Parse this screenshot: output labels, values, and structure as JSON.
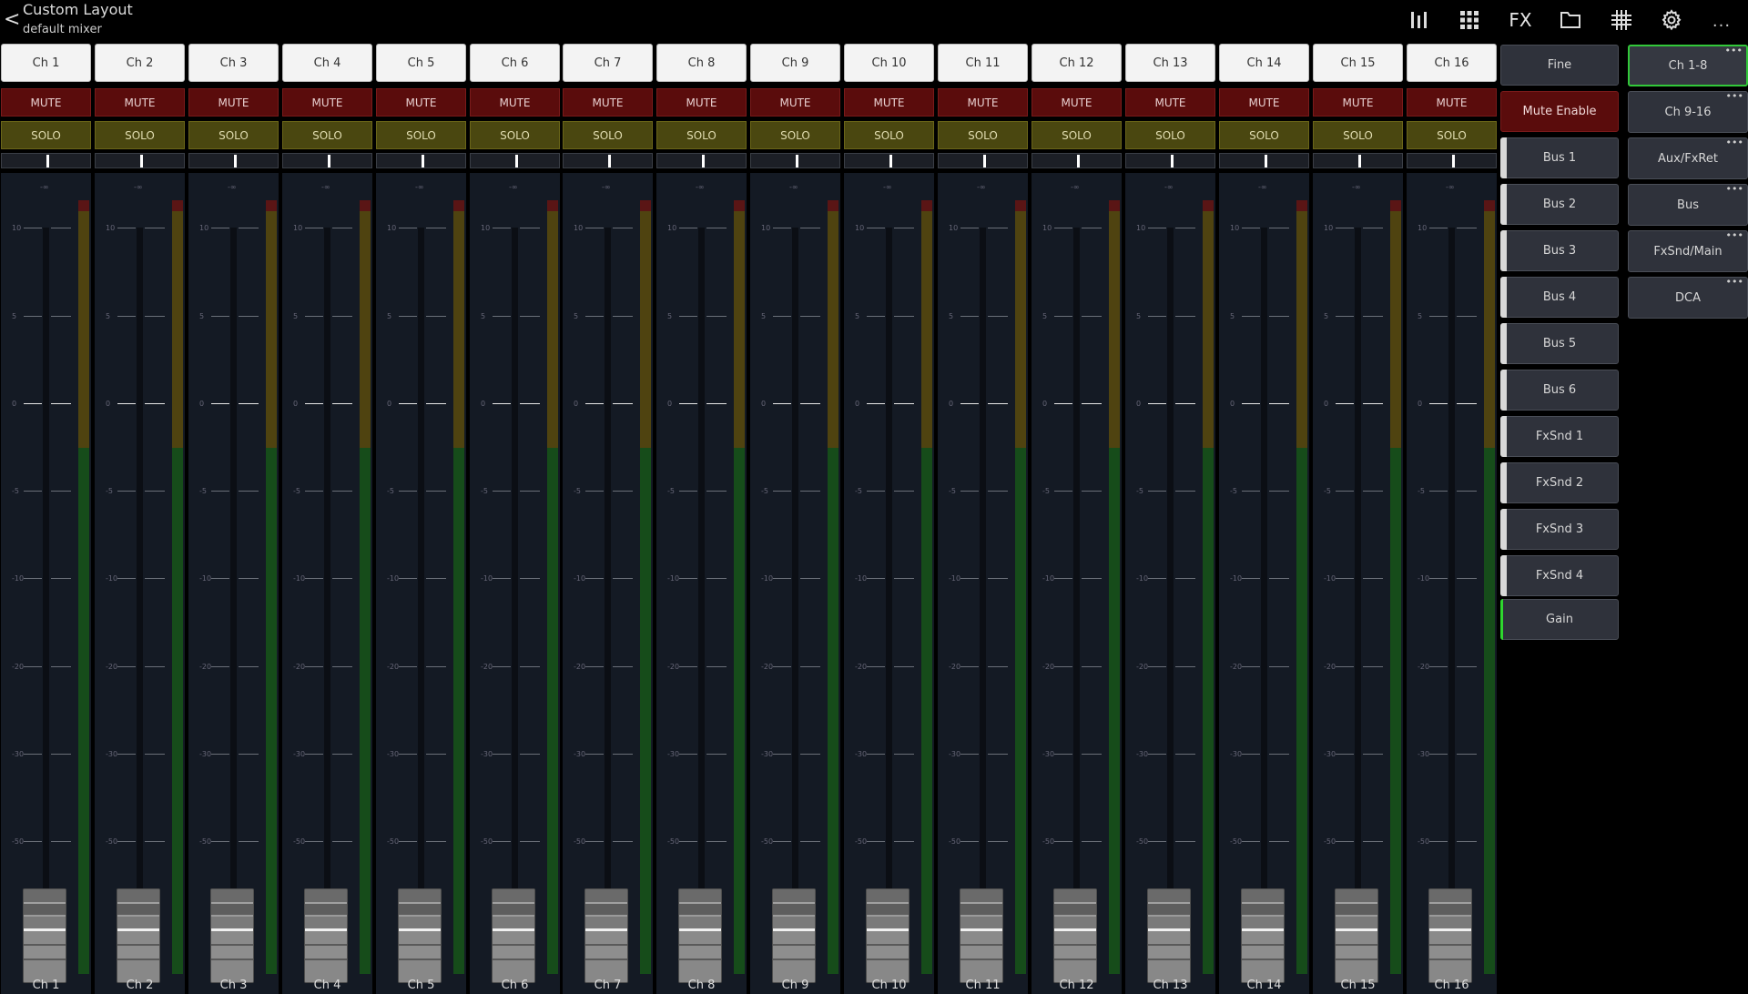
{
  "header": {
    "back_glyph": "<",
    "title": "Custom Layout",
    "subtitle": "default mixer",
    "icons": {
      "mixer": "mixer-faders-icon",
      "grid": "channel-grid-icon",
      "fx": "FX",
      "folder": "folder-icon",
      "routing": "routing-matrix-icon",
      "settings": "gear-icon",
      "more": "..."
    }
  },
  "strip_labels": {
    "mute": "MUTE",
    "solo": "SOLO",
    "scale": [
      "-∞",
      "10",
      "5",
      "0",
      "-5",
      "-10",
      "-20",
      "-30",
      "-50"
    ]
  },
  "channels": [
    {
      "name": "Ch 1"
    },
    {
      "name": "Ch 2"
    },
    {
      "name": "Ch 3"
    },
    {
      "name": "Ch 4"
    },
    {
      "name": "Ch 5"
    },
    {
      "name": "Ch 6"
    },
    {
      "name": "Ch 7"
    },
    {
      "name": "Ch 8"
    },
    {
      "name": "Ch 9"
    },
    {
      "name": "Ch 10"
    },
    {
      "name": "Ch 11"
    },
    {
      "name": "Ch 12"
    },
    {
      "name": "Ch 13"
    },
    {
      "name": "Ch 14"
    },
    {
      "name": "Ch 15"
    },
    {
      "name": "Ch 16"
    }
  ],
  "sends_column": {
    "fine": "Fine",
    "mute_enable": "Mute Enable",
    "buses": [
      "Bus 1",
      "Bus 2",
      "Bus 3",
      "Bus 4",
      "Bus 5",
      "Bus 6"
    ],
    "fx_sends": [
      "FxSnd 1",
      "FxSnd 2",
      "FxSnd 3",
      "FxSnd 4"
    ],
    "gain": "Gain"
  },
  "layers": {
    "items": [
      "Ch 1-8",
      "Ch 9-16",
      "Aux/FxRet",
      "Bus",
      "FxSnd/Main",
      "DCA"
    ],
    "active": "Ch 1-8",
    "dots": "•••"
  },
  "colors": {
    "mute_bg": "#5a0c0c",
    "solo_bg": "#4a4710",
    "active_layer_border": "#32c83a",
    "gain_stripe": "#2fd62f"
  }
}
